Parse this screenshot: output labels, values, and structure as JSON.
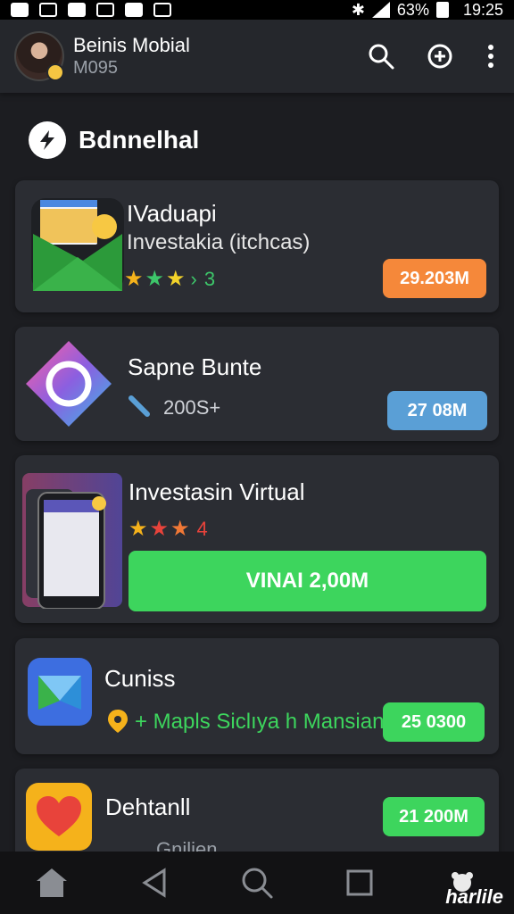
{
  "status_bar": {
    "battery": "63%",
    "time": "19:25"
  },
  "header": {
    "title": "Beinis Mobial",
    "subtitle": "M095"
  },
  "section": {
    "title": "Bdnnelhal"
  },
  "cards": [
    {
      "title": "IVaduapi",
      "subtitle": "Investakia (itchcas)",
      "rating_text": "3",
      "pill": "29.203M",
      "pill_color": "#f5883a"
    },
    {
      "title": "Sapne Bunte",
      "subtitle": "200S+",
      "pill": "27 08M",
      "pill_color": "#5a9fd6"
    },
    {
      "title": "Investasin Virtual",
      "rating_text": "4",
      "pill": "VINAI 2,00M",
      "pill_color": "#3dd55d"
    },
    {
      "title": "Cuniss",
      "subtitle": "+ Mapls Siclıya h Mansian",
      "pill": "25 0300",
      "pill_color": "#3dd55d"
    },
    {
      "title": "Dehtanll",
      "subtitle": "Gnilien",
      "pill": "21 200M",
      "pill_color": "#3dd55d"
    }
  ],
  "watermark": "harlile",
  "icons": [
    "search-icon",
    "add-circle-icon",
    "more-vert-icon",
    "home-icon",
    "back-icon",
    "search-icon",
    "recents-icon"
  ]
}
